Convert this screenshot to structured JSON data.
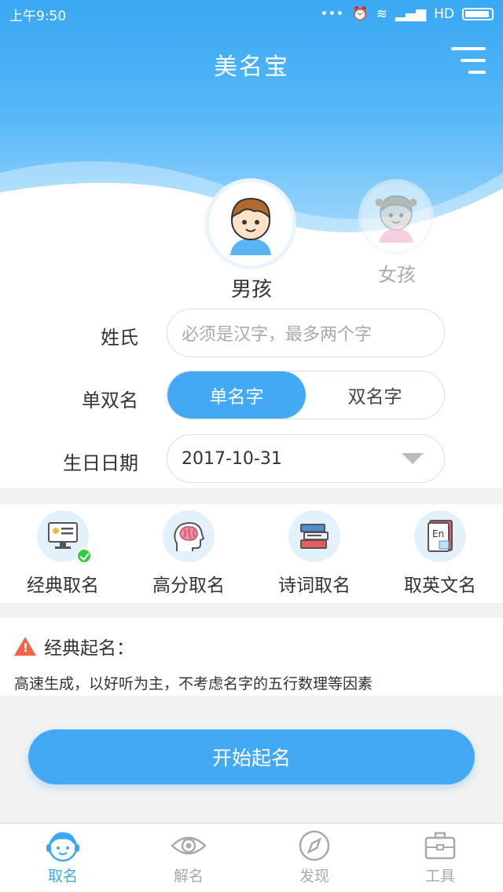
{
  "status_bar": {
    "time": "上午9:50",
    "network": "HD"
  },
  "app": {
    "title": "美名宝"
  },
  "gender": {
    "boy_label": "男孩",
    "girl_label": "女孩",
    "selected": "boy"
  },
  "form": {
    "surname_label": "姓氏",
    "surname_placeholder": "必须是汉字，最多两个字",
    "name_type_label": "单双名",
    "name_type_options": [
      "单名字",
      "双名字"
    ],
    "name_type_selected": "单名字",
    "birthday_label": "生日日期",
    "birthday_value": "2017-10-31"
  },
  "methods": [
    {
      "label": "经典取名",
      "icon": "computer-icon",
      "selected": true
    },
    {
      "label": "高分取名",
      "icon": "brain-icon",
      "selected": false
    },
    {
      "label": "诗词取名",
      "icon": "books-icon",
      "selected": false
    },
    {
      "label": "取英文名",
      "icon": "english-book-icon",
      "selected": false
    }
  ],
  "info": {
    "title": "经典起名：",
    "description": "高速生成，以好听为主，不考虑名字的五行数理等因素"
  },
  "start_button": "开始起名",
  "tabs": [
    {
      "label": "取名",
      "icon": "face-icon",
      "active": true
    },
    {
      "label": "解名",
      "icon": "eye-icon",
      "active": false
    },
    {
      "label": "发现",
      "icon": "compass-icon",
      "active": false
    },
    {
      "label": "工具",
      "icon": "toolbox-icon",
      "active": false
    }
  ],
  "colors": {
    "primary": "#44a9f5",
    "header": "#3aa8f3",
    "warning": "#f0644a",
    "check": "#2ecc40"
  }
}
